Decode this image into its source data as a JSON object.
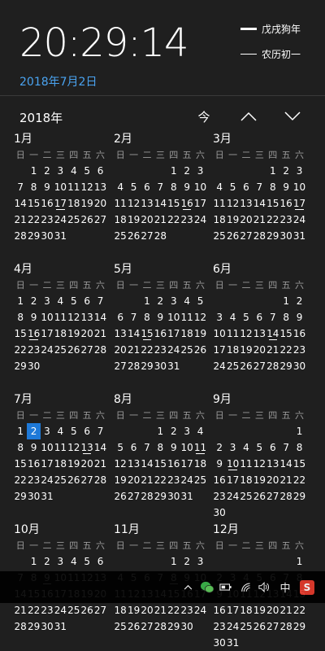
{
  "clock": {
    "time": "20:29:14",
    "date": "2018年7月2日"
  },
  "lunar": {
    "line1": "戊戌狗年",
    "line2": "农历初一"
  },
  "nav": {
    "year": "2018年",
    "today_label": "今"
  },
  "weekday_labels": [
    "日",
    "一",
    "二",
    "三",
    "四",
    "五",
    "六"
  ],
  "months": [
    {
      "name": "1月",
      "offset": 1,
      "days": 31,
      "festival": [
        17
      ],
      "today": null
    },
    {
      "name": "2月",
      "offset": 4,
      "days": 28,
      "festival": [
        16
      ],
      "today": null
    },
    {
      "name": "3月",
      "offset": 4,
      "days": 31,
      "festival": [
        17
      ],
      "today": null
    },
    {
      "name": "4月",
      "offset": 0,
      "days": 30,
      "festival": [
        16
      ],
      "today": null
    },
    {
      "name": "5月",
      "offset": 2,
      "days": 31,
      "festival": [
        15
      ],
      "today": null
    },
    {
      "name": "6月",
      "offset": 5,
      "days": 30,
      "festival": [
        14
      ],
      "today": null
    },
    {
      "name": "7月",
      "offset": 0,
      "days": 31,
      "festival": [
        13
      ],
      "today": 2
    },
    {
      "name": "8月",
      "offset": 3,
      "days": 31,
      "festival": [
        11
      ],
      "today": null
    },
    {
      "name": "9月",
      "offset": 6,
      "days": 30,
      "festival": [
        10
      ],
      "today": null
    },
    {
      "name": "10月",
      "offset": 1,
      "days": 31,
      "festival": [
        9
      ],
      "today": null
    },
    {
      "name": "11月",
      "offset": 4,
      "days": 30,
      "festival": [
        8
      ],
      "today": null
    },
    {
      "name": "12月",
      "offset": 6,
      "days": 31,
      "festival": [],
      "today": null
    }
  ],
  "taskbar": {
    "up_icon": "chevron-up-icon",
    "wechat_icon": "wechat-icon",
    "battery_icon": "battery-icon",
    "wifi_icon": "wifi-icon",
    "volume_icon": "volume-icon",
    "ime_label": "中",
    "sogou_label": "S"
  },
  "colors": {
    "accent": "#1e79d8",
    "date_link": "#4aa3f0",
    "background": "#1f1f1f"
  }
}
